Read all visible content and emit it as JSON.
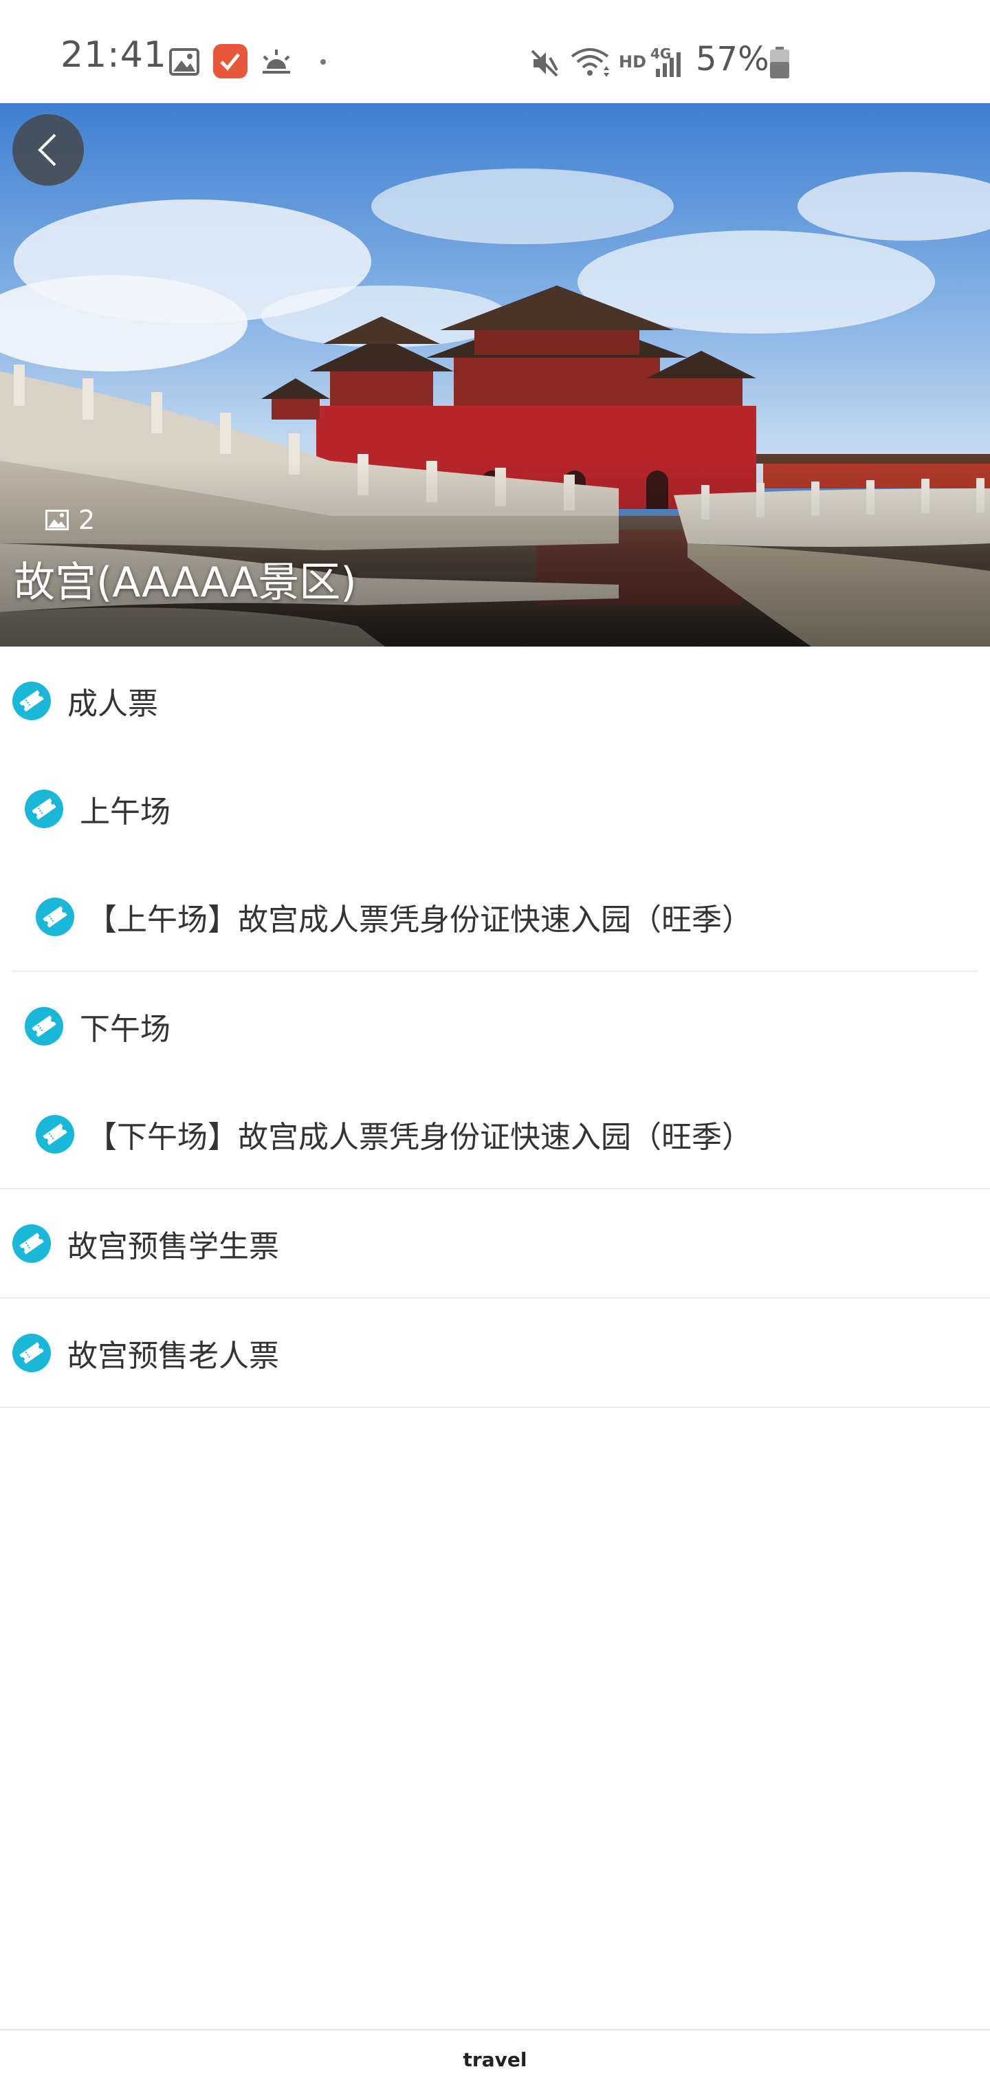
{
  "status_bar": {
    "time": "21:41",
    "network_hd": "HD",
    "network_type": "4G",
    "battery": "57%",
    "icons": [
      "gallery-icon",
      "check-app-icon",
      "sunrise-icon",
      "dot-icon",
      "mute-icon",
      "wifi-icon",
      "signal-icon",
      "battery-icon"
    ],
    "app_badge_color": "#e8573a"
  },
  "hero": {
    "photo_count": "2",
    "title": "故宫(AAAAA景区)"
  },
  "tickets": {
    "icon_color": "#1ab8d8",
    "adult": {
      "label": "成人票",
      "morning": {
        "label": "上午场",
        "item": "【上午场】故宫成人票凭身份证快速入园（旺季）"
      },
      "afternoon": {
        "label": "下午场",
        "item": "【下午场】故宫成人票凭身份证快速入园（旺季）"
      }
    },
    "student": {
      "label": "故宫预售学生票"
    },
    "senior": {
      "label": "故宫预售老人票"
    }
  },
  "bottom_bar": {
    "label": "travel"
  }
}
